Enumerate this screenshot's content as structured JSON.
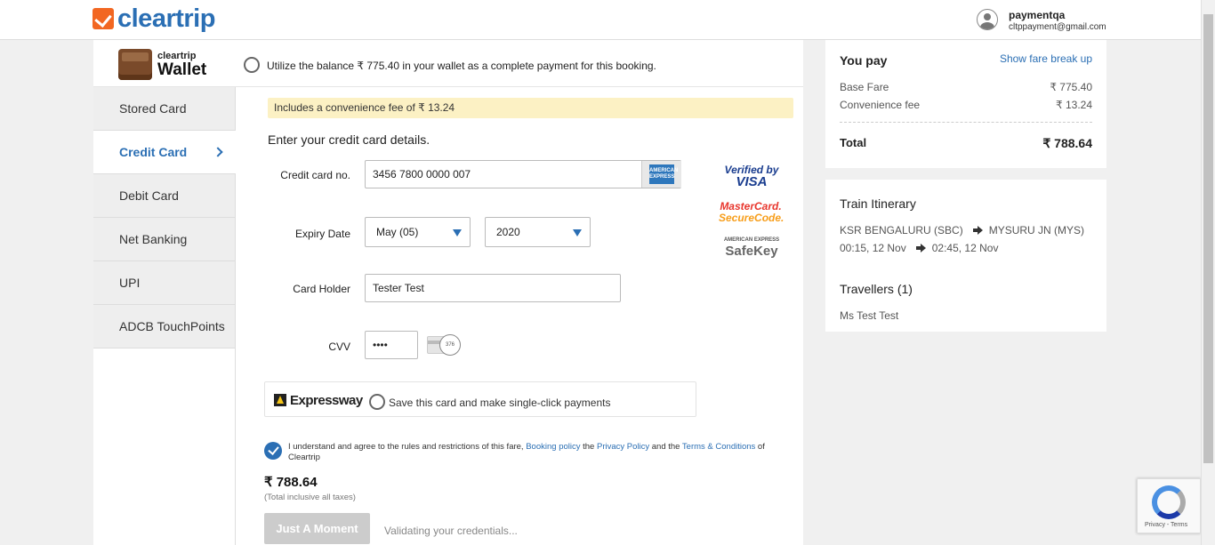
{
  "header": {
    "logo_text": "cleartrip",
    "user_name": "paymentqa",
    "user_email": "cltppayment@gmail.com"
  },
  "wallet": {
    "brand_small": "cleartrip",
    "brand_big": "Wallet",
    "text": "Utilize the balance ₹ 775.40 in your wallet as a complete payment for this booking."
  },
  "tabs": [
    {
      "label": "Stored Card"
    },
    {
      "label": "Credit Card"
    },
    {
      "label": "Debit Card"
    },
    {
      "label": "Net Banking"
    },
    {
      "label": "UPI"
    },
    {
      "label": "ADCB TouchPoints"
    }
  ],
  "fee_note": "Includes a convenience fee of ₹ 13.24",
  "form": {
    "heading": "Enter your credit card details.",
    "card_no_label": "Credit card no.",
    "card_no_value": "3456 7800 0000 007",
    "amex_text": "AMERICAN EXPRESS",
    "expiry_label": "Expiry Date",
    "expiry_month": "May (05)",
    "expiry_year": "2020",
    "holder_label": "Card Holder",
    "holder_value": "Tester Test",
    "cvv_label": "CVV",
    "cvv_value": "••••",
    "cvv_hint": "376"
  },
  "badges": {
    "visa_line1": "Verified by",
    "visa_line2": "VISA",
    "mc_line1": "MasterCard.",
    "mc_line2": "SecureCode.",
    "sk_line1": "AMERICAN EXPRESS",
    "sk_line2": "SafeKey"
  },
  "expressway": {
    "title": "Expressway",
    "text": "Save this card and make single-click payments"
  },
  "agree": {
    "part1": "I understand and agree to the rules and restrictions of this fare, ",
    "link1": "Booking policy",
    "part2": " the ",
    "link2": "Privacy Policy",
    "part3": " and the ",
    "link3": "Terms & Conditions",
    "part4": " of Cleartrip"
  },
  "payment": {
    "amount": "₹ 788.64",
    "note": "(Total inclusive all taxes)",
    "button": "Just A Moment",
    "status": "Validating your credentials..."
  },
  "summary": {
    "title": "You pay",
    "link": "Show fare break up",
    "rows": [
      {
        "label": "Base Fare",
        "value": "₹ 775.40"
      },
      {
        "label": "Convenience fee",
        "value": "₹ 13.24"
      }
    ],
    "total_label": "Total",
    "total_value": "₹ 788.64"
  },
  "itinerary": {
    "title": "Train Itinerary",
    "from": "KSR BENGALURU (SBC)",
    "to": "MYSURU JN (MYS)",
    "depart": "00:15, 12 Nov",
    "arrive": "02:45, 12 Nov",
    "travellers_title": "Travellers (1)",
    "traveller": "Ms Test Test"
  },
  "recaptcha": {
    "text": "Privacy - Terms"
  }
}
